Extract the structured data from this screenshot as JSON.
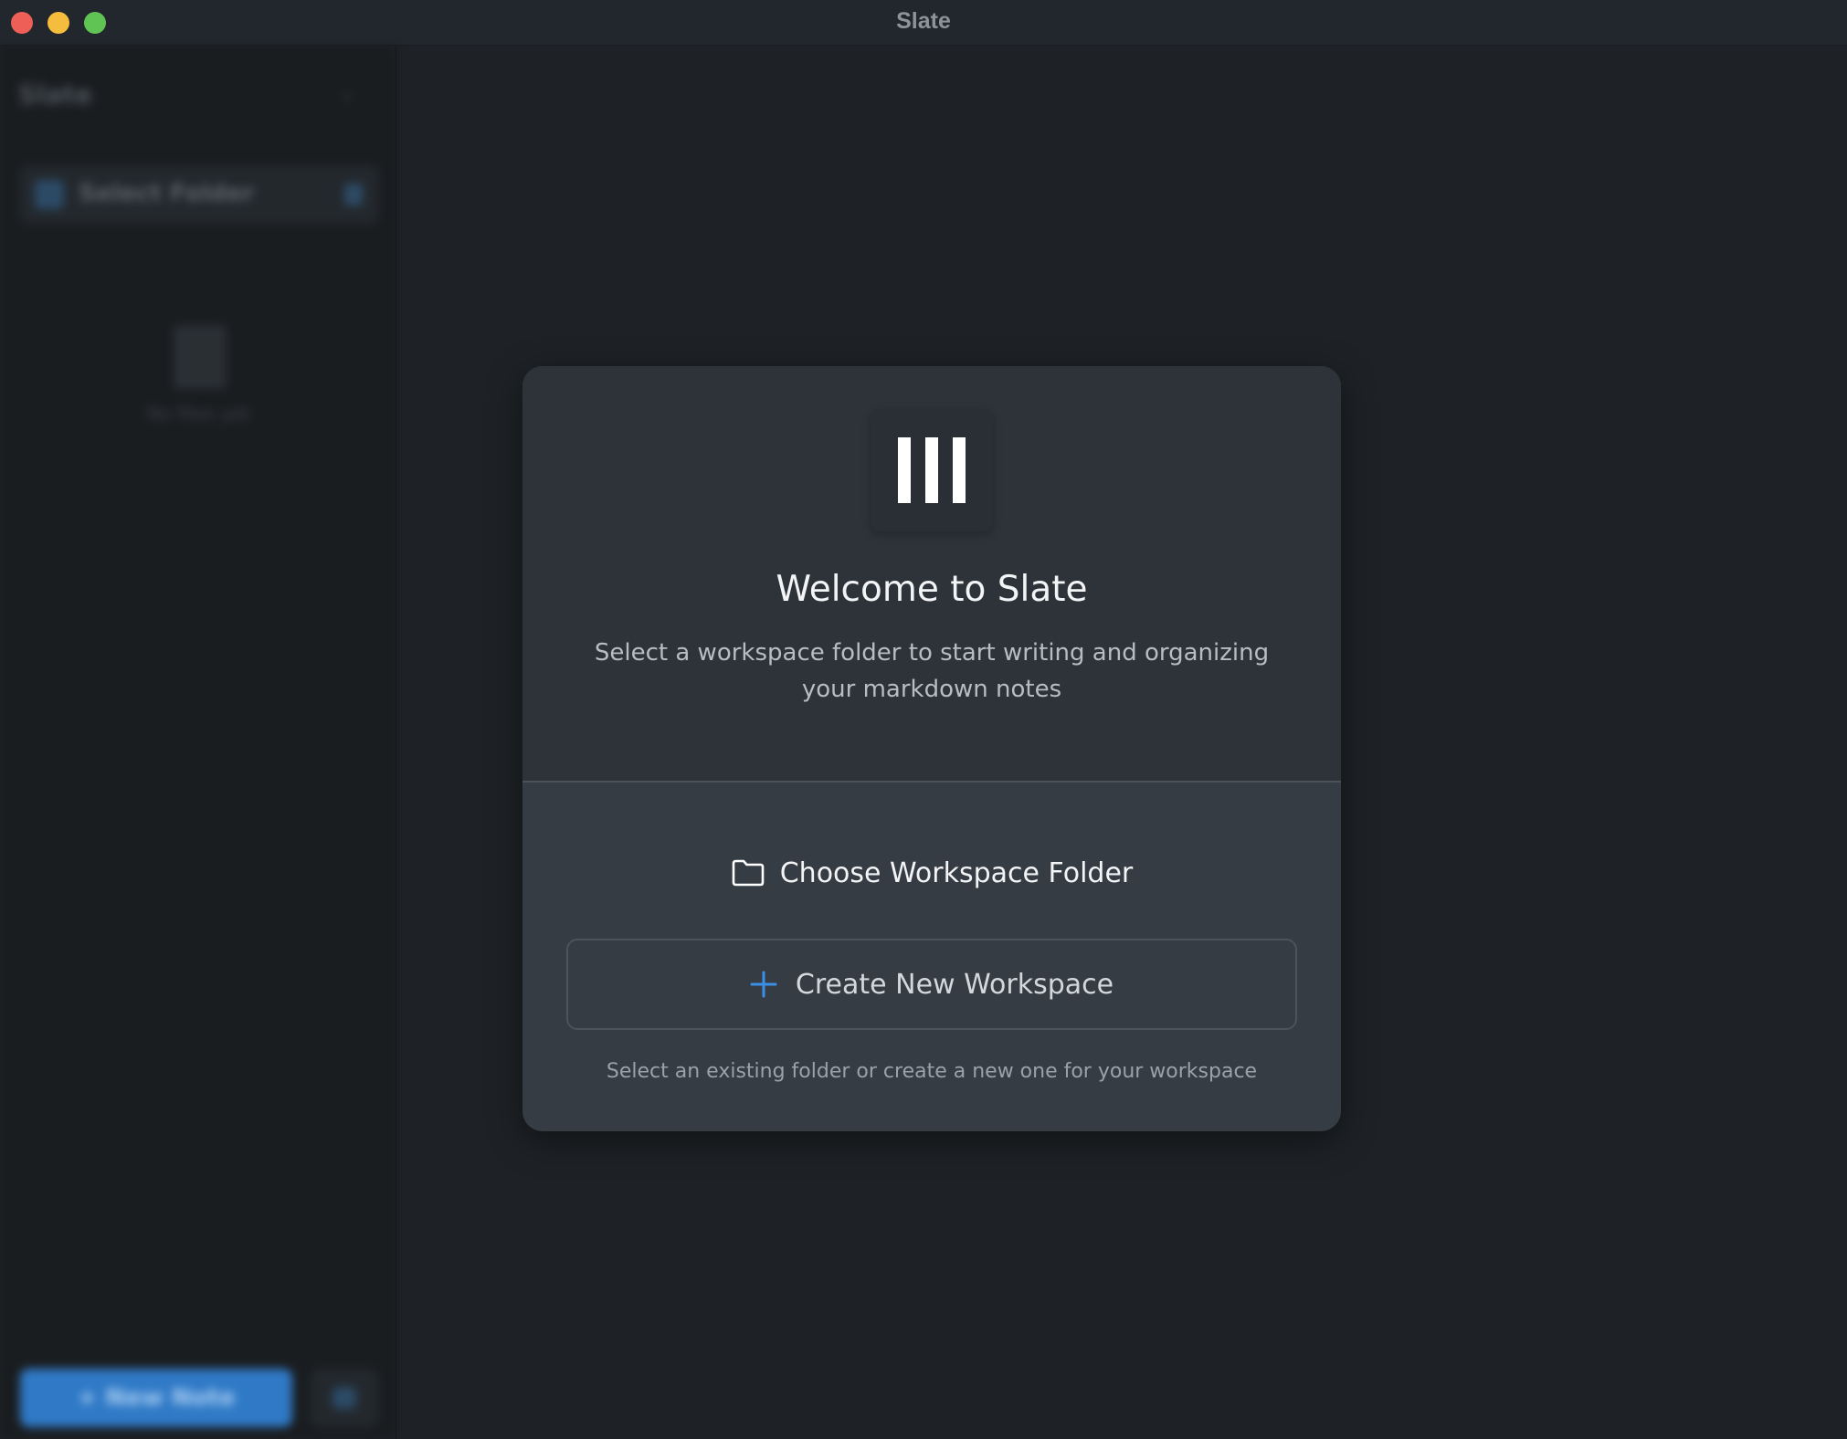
{
  "window": {
    "title": "Slate"
  },
  "sidebar": {
    "title": "Slate",
    "folder_label": "Select Folder",
    "empty_label": "No files yet",
    "new_note_label": "+ New Note"
  },
  "modal": {
    "title": "Welcome to Slate",
    "subtitle": "Select a workspace folder to start writing and organizing your markdown notes",
    "choose_label": "Choose Workspace Folder",
    "create_label": "Create New Workspace",
    "hint": "Select an existing folder or create a new one for your workspace",
    "icons": {
      "logo": "slate-logo",
      "choose": "folder-icon",
      "create": "plus-icon"
    }
  },
  "colors": {
    "accent": "#3b8fe6",
    "background": "#1e2226",
    "modal_bg": "#363c43",
    "modal_top_bg": "#2e3339"
  }
}
